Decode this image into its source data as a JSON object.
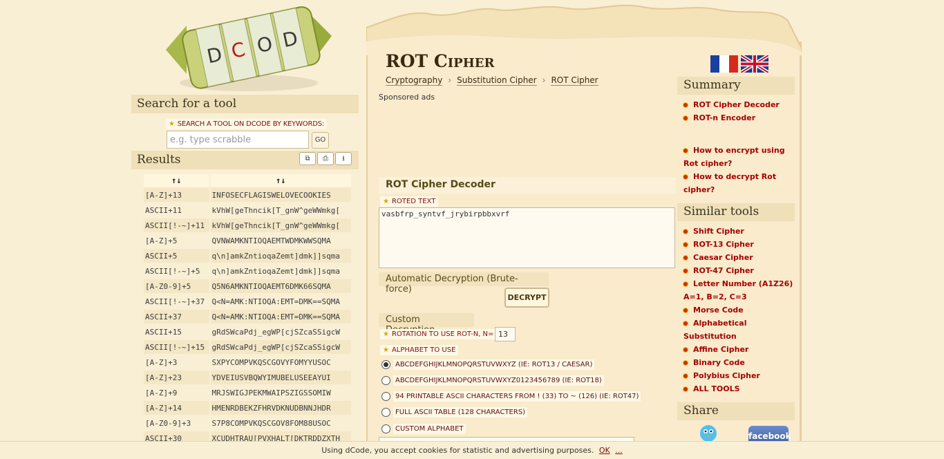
{
  "search": {
    "heading": "Search for a tool",
    "label": "SEARCH A TOOL ON DCODE BY KEYWORDS:",
    "placeholder": "e.g. type scrabble",
    "go_label": "GO"
  },
  "results": {
    "heading": "Results",
    "columns": [
      "↑↓",
      "↑↓"
    ],
    "rows": [
      [
        "[A-Z]+13",
        "INFOSECFLAGISWELOVECOOKIES"
      ],
      [
        "ASCII+11",
        "kVhW[geThncik[T_gnW^geWWmkg["
      ],
      [
        "ASCII[!-~]+11",
        "kVhW[geThncik[T_gnW^geWWmkg["
      ],
      [
        "[A-Z]+5",
        "QVNWAMKNTIOQAEMTWDMKWWSQMA"
      ],
      [
        "ASCII+5",
        "q\\n]amkZntioqaZemt]dmk]]sqma"
      ],
      [
        "ASCII[!-~]+5",
        "q\\n]amkZntioqaZemt]dmk]]sqma"
      ],
      [
        "[A-Z0-9]+5",
        "Q5N6AMKNTIOQAEMT6DMK66SQMA"
      ],
      [
        "ASCII[!-~]+37",
        "Q<N=AMK:NTIOQA:EMT=DMK==SQMA"
      ],
      [
        "ASCII+37",
        "Q<N=AMK:NTIOQA:EMT=DMK==SQMA"
      ],
      [
        "ASCII+15",
        "gRdSWcaPdj_egWP[cjSZcaSSigcW"
      ],
      [
        "ASCII[!-~]+15",
        "gRdSWcaPdj_egWP[cjSZcaSSigcW"
      ],
      [
        "[A-Z]+3",
        "SXPYCOMPVKQSCGOVYFOMYYUSOC"
      ],
      [
        "[A-Z]+23",
        "YDVEIUSVBQWYIMUBELUSEEAYUI"
      ],
      [
        "[A-Z]+9",
        "MRJSWIGJPEKMWAIPSZIGSSOMIW"
      ],
      [
        "[A-Z]+14",
        "HMENRDBEKZFHRVDKNUDBNNJHDR"
      ],
      [
        "[A-Z0-9]+3",
        "S7P8COMPVKQSCGOV8FOM88USOC"
      ],
      [
        "ASCII+30",
        "XCUDHTRAU[PVXHALT[DKTRDDZXTH"
      ]
    ]
  },
  "page": {
    "title": "ROT Cipher",
    "breadcrumb": [
      "Cryptography",
      "Substitution Cipher",
      "ROT Cipher"
    ],
    "sponsored": "Sponsored ads"
  },
  "decoder": {
    "heading": "ROT Cipher Decoder",
    "roted_label": "ROTED TEXT",
    "roted_value": "vasbfrp_syntvf_jrybirpbbxvrf",
    "auto_heading": "Automatic Decryption (Brute-force)",
    "decrypt_label": "DECRYPT",
    "custom_heading": "Custom Decryption",
    "rotation_label": "ROTATION TO USE ROT-N, N=",
    "rotation_value": "13",
    "alphabet_label": "ALPHABET TO USE",
    "alphabet_options": [
      {
        "label": "ABCDEFGHIJKLMNOPQRSTUVWXYZ (IE: ROT13 / CAESAR)",
        "checked": true
      },
      {
        "label": "ABCDEFGHIJKLMNOPQRSTUVWXYZ0123456789 (IE: ROT18)",
        "checked": false
      },
      {
        "label": "94 PRINTABLE ASCII CHARACTERS FROM ! (33) TO ~ (126) (IE: ROT47)",
        "checked": false
      },
      {
        "label": "FULL ASCII TABLE (128 CHARACTERS)",
        "checked": false
      },
      {
        "label": "CUSTOM ALPHABET",
        "checked": false
      }
    ]
  },
  "summary": {
    "heading": "Summary",
    "items": [
      "ROT Cipher Decoder",
      "ROT-n Encoder"
    ],
    "faq": [
      "How to encrypt using Rot cipher?",
      "How to decrypt Rot cipher?"
    ]
  },
  "similar": {
    "heading": "Similar tools",
    "items": [
      "Shift Cipher",
      "ROT-13 Cipher",
      "Caesar Cipher",
      "ROT-47 Cipher",
      "Letter Number (A1Z26) A=1, B=2, C=3",
      "Morse Code",
      "Alphabetical Substitution",
      "Affine Cipher",
      "Binary Code",
      "Polybius Cipher",
      "ALL TOOLS"
    ]
  },
  "share": {
    "heading": "Share",
    "facebook_label": "facebook"
  },
  "cookie": {
    "text": "Using dCode, you accept cookies for statistic and advertising purposes.",
    "ok": "OK",
    "more": "..."
  },
  "logo": {
    "text": "DCODE"
  },
  "colors": {
    "accent": "#8b0000",
    "panel": "#efe0b9",
    "background": "#f9efd5"
  }
}
